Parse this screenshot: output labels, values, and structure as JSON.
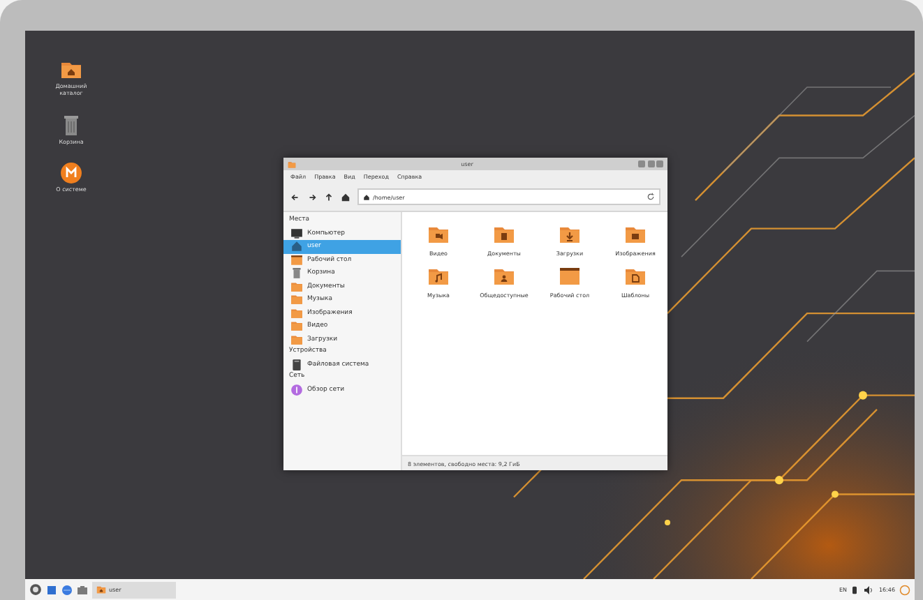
{
  "desktop_icons": [
    {
      "label": "Домашний каталог",
      "kind": "home"
    },
    {
      "label": "Корзина",
      "kind": "trash"
    },
    {
      "label": "О системе",
      "kind": "about"
    }
  ],
  "window": {
    "title": "user",
    "menu": [
      "Файл",
      "Правка",
      "Вид",
      "Переход",
      "Справка"
    ],
    "path": "/home/user",
    "sidebar": [
      {
        "heading": "Места",
        "items": [
          {
            "label": "Компьютер",
            "kind": "computer",
            "selected": false
          },
          {
            "label": "user",
            "kind": "home",
            "selected": true
          },
          {
            "label": "Рабочий стол",
            "kind": "desktop",
            "selected": false
          },
          {
            "label": "Корзина",
            "kind": "trash",
            "selected": false
          },
          {
            "label": "Документы",
            "kind": "folder",
            "selected": false
          },
          {
            "label": "Музыка",
            "kind": "folder",
            "selected": false
          },
          {
            "label": "Изображения",
            "kind": "folder",
            "selected": false
          },
          {
            "label": "Видео",
            "kind": "folder",
            "selected": false
          },
          {
            "label": "Загрузки",
            "kind": "folder",
            "selected": false
          }
        ]
      },
      {
        "heading": "Устройства",
        "items": [
          {
            "label": "Файловая система",
            "kind": "drive",
            "selected": false
          }
        ]
      },
      {
        "heading": "Сеть",
        "items": [
          {
            "label": "Обзор сети",
            "kind": "network",
            "selected": false
          }
        ]
      }
    ],
    "files": [
      {
        "label": "Видео",
        "kind": "video"
      },
      {
        "label": "Документы",
        "kind": "docs"
      },
      {
        "label": "Загрузки",
        "kind": "download"
      },
      {
        "label": "Изображения",
        "kind": "image"
      },
      {
        "label": "Музыка",
        "kind": "music"
      },
      {
        "label": "Общедоступные",
        "kind": "public"
      },
      {
        "label": "Рабочий стол",
        "kind": "desktop"
      },
      {
        "label": "Шаблоны",
        "kind": "templates"
      }
    ],
    "status": "8 элементов, свободно места: 9,2 ГиБ"
  },
  "taskbar": {
    "tasks": [
      {
        "label": "user"
      }
    ],
    "lang": "EN",
    "clock": "16:46"
  }
}
